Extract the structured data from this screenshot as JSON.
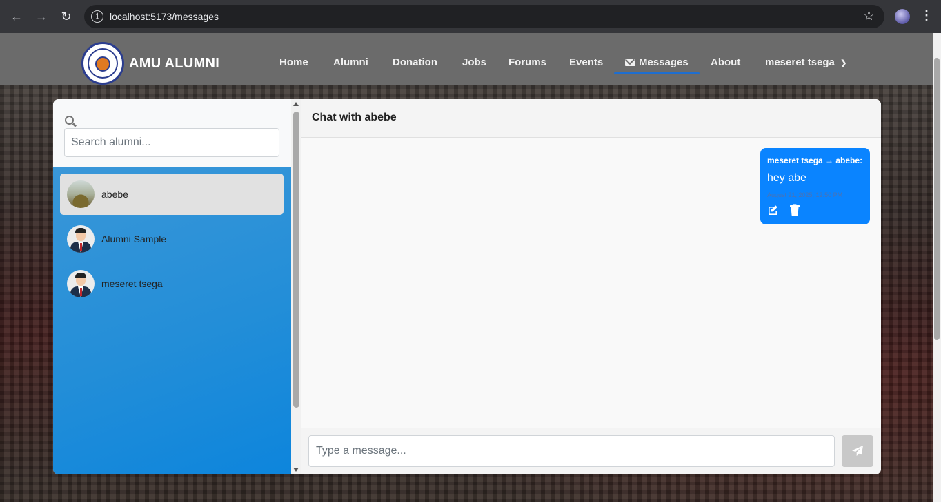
{
  "browser": {
    "url": "localhost:5173/messages",
    "back_icon": "arrow-left-icon",
    "forward_icon": "arrow-right-icon",
    "reload_icon": "reload-icon",
    "bookmark_icon": "star-icon",
    "menu_icon": "kebab-icon"
  },
  "header": {
    "brand": "AMU ALUMNI",
    "nav": [
      {
        "label": "Home"
      },
      {
        "label": "Alumni"
      },
      {
        "label": "Donation"
      },
      {
        "label": "Jobs"
      },
      {
        "label": "Forums"
      },
      {
        "label": "Events"
      },
      {
        "label": "Messages",
        "active": true,
        "icon": "envelope-icon"
      },
      {
        "label": "About"
      }
    ],
    "user_menu": {
      "label": "meseret tsega",
      "icon": "chevron-down-icon"
    },
    "accent_color": "#1e6ed0"
  },
  "sidebar": {
    "search_placeholder": "Search alumni...",
    "users": [
      {
        "name": "abebe",
        "active": true,
        "avatar": "photo"
      },
      {
        "name": "Alumni Sample",
        "active": false,
        "avatar": "default-male"
      },
      {
        "name": "meseret tsega",
        "active": false,
        "avatar": "default-male"
      }
    ]
  },
  "chat": {
    "title": "Chat with abebe",
    "messages": [
      {
        "sender": "meseret tsega → abebe:",
        "text": "hey abe",
        "time": "August 21, 2025, 12:50 PM",
        "bubble_color": "#0a84ff"
      }
    ],
    "input_placeholder": "Type a message...",
    "send_icon": "paper-plane-icon"
  }
}
